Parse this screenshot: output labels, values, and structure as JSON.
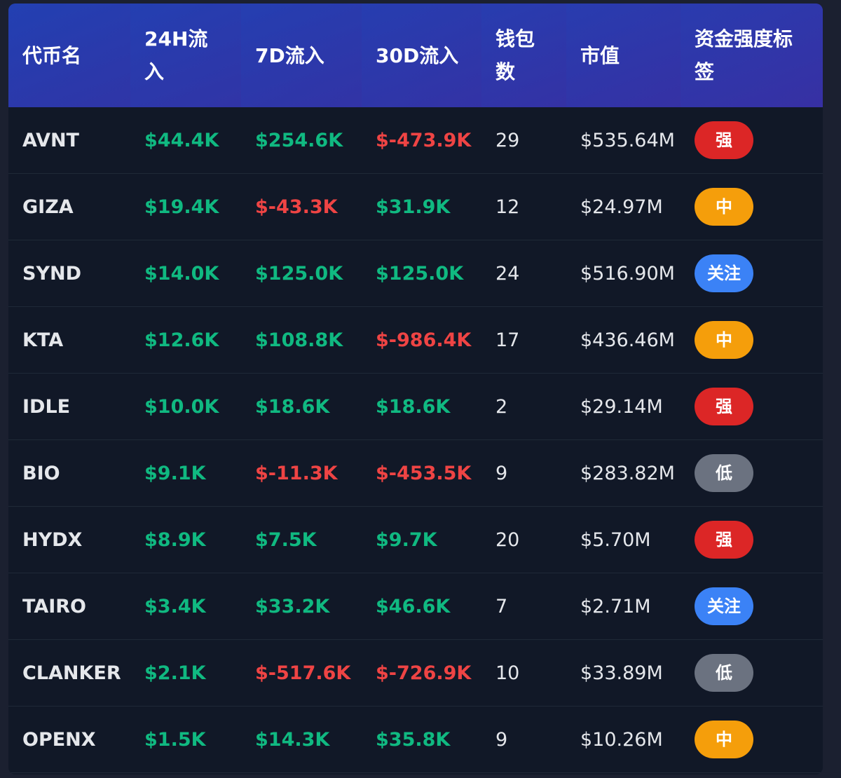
{
  "headers": [
    "代币名",
    "24H流入",
    "7D流入",
    "30D流入",
    "钱包数",
    "市值",
    "资金强度标签"
  ],
  "rows": [
    {
      "token": "AVNT",
      "h24": "$44.4K",
      "d7": "$254.6K",
      "d30": "$-473.9K",
      "wallets": "29",
      "mcap": "$535.64M",
      "tag": "强"
    },
    {
      "token": "GIZA",
      "h24": "$19.4K",
      "d7": "$-43.3K",
      "d30": "$31.9K",
      "wallets": "12",
      "mcap": "$24.97M",
      "tag": "中"
    },
    {
      "token": "SYND",
      "h24": "$14.0K",
      "d7": "$125.0K",
      "d30": "$125.0K",
      "wallets": "24",
      "mcap": "$516.90M",
      "tag": "关注"
    },
    {
      "token": "KTA",
      "h24": "$12.6K",
      "d7": "$108.8K",
      "d30": "$-986.4K",
      "wallets": "17",
      "mcap": "$436.46M",
      "tag": "中"
    },
    {
      "token": "IDLE",
      "h24": "$10.0K",
      "d7": "$18.6K",
      "d30": "$18.6K",
      "wallets": "2",
      "mcap": "$29.14M",
      "tag": "强"
    },
    {
      "token": "BIO",
      "h24": "$9.1K",
      "d7": "$-11.3K",
      "d30": "$-453.5K",
      "wallets": "9",
      "mcap": "$283.82M",
      "tag": "低"
    },
    {
      "token": "HYDX",
      "h24": "$8.9K",
      "d7": "$7.5K",
      "d30": "$9.7K",
      "wallets": "20",
      "mcap": "$5.70M",
      "tag": "强"
    },
    {
      "token": "TAIRO",
      "h24": "$3.4K",
      "d7": "$33.2K",
      "d30": "$46.6K",
      "wallets": "7",
      "mcap": "$2.71M",
      "tag": "关注"
    },
    {
      "token": "CLANKER",
      "h24": "$2.1K",
      "d7": "$-517.6K",
      "d30": "$-726.9K",
      "wallets": "10",
      "mcap": "$33.89M",
      "tag": "低"
    },
    {
      "token": "OPENX",
      "h24": "$1.5K",
      "d7": "$14.3K",
      "d30": "$35.8K",
      "wallets": "9",
      "mcap": "$10.26M",
      "tag": "中"
    }
  ],
  "tag_colors": {
    "强": "#dc2626",
    "中": "#f59e0b",
    "关注": "#3b82f6",
    "低": "#6b7280"
  },
  "colors": {
    "positive": "#10b981",
    "negative": "#ef4444"
  }
}
